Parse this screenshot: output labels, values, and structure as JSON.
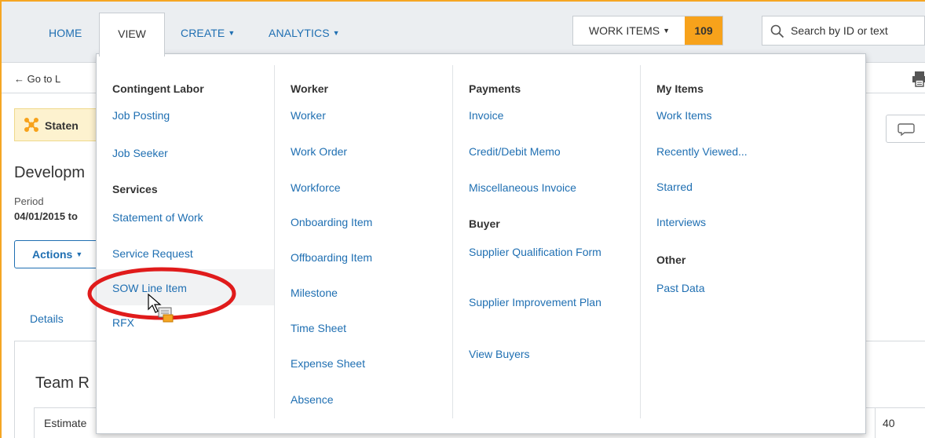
{
  "topnav": {
    "home": "HOME",
    "view": "VIEW",
    "create": "CREATE",
    "analytics": "ANALYTICS",
    "caret": "▼",
    "work_items_label": "WORK ITEMS",
    "work_items_count": "109",
    "search_placeholder": "Search by ID or text"
  },
  "page": {
    "go_to": "← Go to L",
    "banner_text": "Staten",
    "title": "Developm",
    "period_label": "Period",
    "period_value": "04/01/2015 to",
    "actions": "Actions",
    "details_tab": "Details",
    "team_title": "Team R",
    "table_col_estimate": "Estimate",
    "table_col_value": "40"
  },
  "menu": {
    "col1": {
      "heading1": "Contingent Labor",
      "items1": [
        "Job Posting",
        "Job Seeker"
      ],
      "heading2": "Services",
      "items2": [
        "Statement of Work",
        "Service Request",
        "SOW Line Item",
        "RFX"
      ]
    },
    "col2": {
      "heading": "Worker",
      "items": [
        "Worker",
        "Work Order",
        "Workforce",
        "Onboarding Item",
        "Offboarding Item",
        "Milestone",
        "Time Sheet",
        "Expense Sheet",
        "Absence"
      ]
    },
    "col3": {
      "heading1": "Payments",
      "items1": [
        "Invoice",
        "Credit/Debit Memo",
        "Miscellaneous Invoice"
      ],
      "heading2": "Buyer",
      "items2": [
        "Supplier Qualification Form",
        "Supplier Improvement Plan",
        "View Buyers"
      ]
    },
    "col4": {
      "heading1": "My Items",
      "items1": [
        "Work Items",
        "Recently Viewed...",
        "Starred",
        "Interviews"
      ],
      "heading2": "Other",
      "items2": [
        "Past Data"
      ]
    }
  },
  "colors": {
    "link": "#1f6fb2",
    "accent_orange": "#f7a21b",
    "annotation_red": "#e01b1b"
  }
}
